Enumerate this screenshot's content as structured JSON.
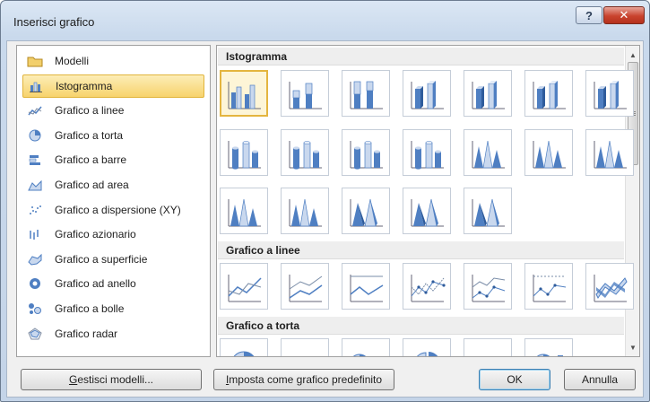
{
  "window": {
    "title": "Inserisci grafico",
    "help_label": "?",
    "close_label": "✕"
  },
  "categories": [
    {
      "label": "Modelli",
      "icon": "folder-icon"
    },
    {
      "label": "Istogramma",
      "icon": "column-chart-icon",
      "selected": true
    },
    {
      "label": "Grafico a linee",
      "icon": "line-chart-icon"
    },
    {
      "label": "Grafico a torta",
      "icon": "pie-chart-icon"
    },
    {
      "label": "Grafico a barre",
      "icon": "bar-chart-icon"
    },
    {
      "label": "Grafico ad area",
      "icon": "area-chart-icon"
    },
    {
      "label": "Grafico a dispersione (XY)",
      "icon": "scatter-chart-icon"
    },
    {
      "label": "Grafico azionario",
      "icon": "stock-chart-icon"
    },
    {
      "label": "Grafico a superficie",
      "icon": "surface-chart-icon"
    },
    {
      "label": "Grafico ad anello",
      "icon": "doughnut-chart-icon"
    },
    {
      "label": "Grafico a bolle",
      "icon": "bubble-chart-icon"
    },
    {
      "label": "Grafico radar",
      "icon": "radar-chart-icon"
    }
  ],
  "gallery": {
    "sections": [
      {
        "title": "Istogramma"
      },
      {
        "title": "Grafico a linee"
      },
      {
        "title": "Grafico a torta"
      }
    ]
  },
  "buttons": {
    "manage_templates": {
      "underline": "G",
      "rest": "estisci modelli..."
    },
    "set_default": {
      "underline": "I",
      "rest": "mposta come grafico predefinito"
    },
    "ok": "OK",
    "cancel": "Annulla"
  },
  "colors": {
    "selection_fill": "#f7d36c",
    "selection_border": "#e1b43b",
    "chart_blue": "#4f7fc2",
    "chart_light": "#c9d8ee"
  }
}
